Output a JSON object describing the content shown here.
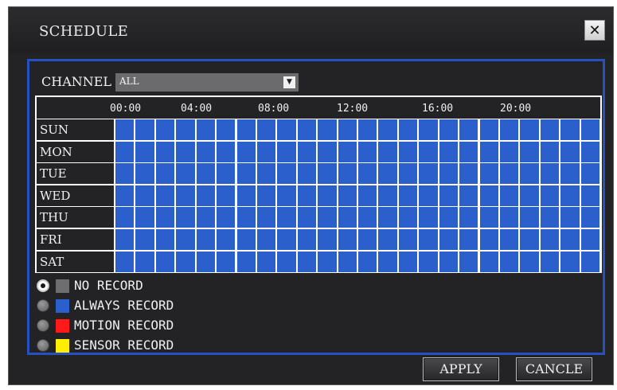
{
  "window": {
    "title": "SCHEDULE",
    "close_label": "✕"
  },
  "channel": {
    "label": "CHANNEL",
    "value": "ALL",
    "arrow": "▼"
  },
  "time_labels": [
    "00:00",
    "04:00",
    "08:00",
    "12:00",
    "16:00",
    "20:00"
  ],
  "days": [
    "SUN",
    "MON",
    "TUE",
    "WED",
    "THU",
    "FRI",
    "SAT"
  ],
  "schedule": {
    "hours": 24,
    "mode_per_hour": "ALWAYS RECORD"
  },
  "legend": [
    {
      "label": "NO RECORD",
      "color": "#6e6e70",
      "selected": true
    },
    {
      "label": "ALWAYS RECORD",
      "color": "#2a5fcc",
      "selected": false
    },
    {
      "label": "MOTION RECORD",
      "color": "#ff1a1a",
      "selected": false
    },
    {
      "label": "SENSOR RECORD",
      "color": "#ffee00",
      "selected": false
    }
  ],
  "buttons": {
    "apply": "APPLY",
    "cancel": "CANCLE"
  },
  "colors": {
    "accent": "#2552c0",
    "cell": "#2a5fcc",
    "background": "#232325"
  }
}
